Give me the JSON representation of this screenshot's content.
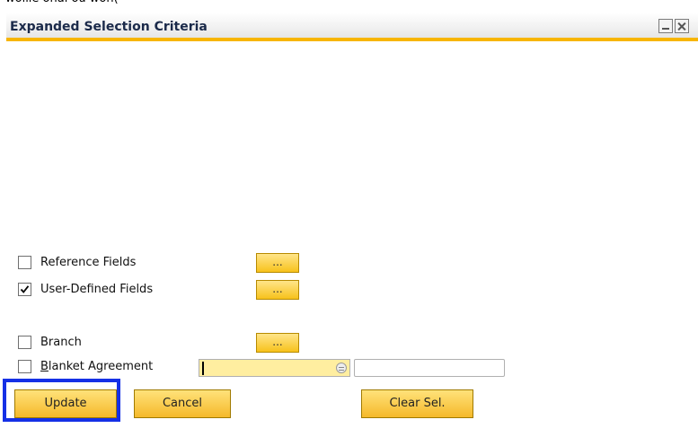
{
  "window": {
    "title": "Expanded Selection Criteria"
  },
  "options": {
    "reference_fields": {
      "label": "Reference Fields",
      "checked": false,
      "button": "..."
    },
    "user_defined_fields": {
      "label": "User-Defined Fields",
      "checked": true,
      "button": "..."
    },
    "branch": {
      "label": "Branch",
      "checked": false,
      "button": "..."
    },
    "blanket_agreement": {
      "label_prefix": "B",
      "label_rest": "lanket Agreement",
      "checked": false,
      "value": "",
      "second_value": ""
    }
  },
  "buttons": {
    "update": "Update",
    "cancel": "Cancel",
    "clear": "Clear Sel."
  },
  "colors": {
    "accent": "#f7b500",
    "button": "#f5c02a",
    "focus": "#1530e6",
    "field": "#ffeea0"
  }
}
